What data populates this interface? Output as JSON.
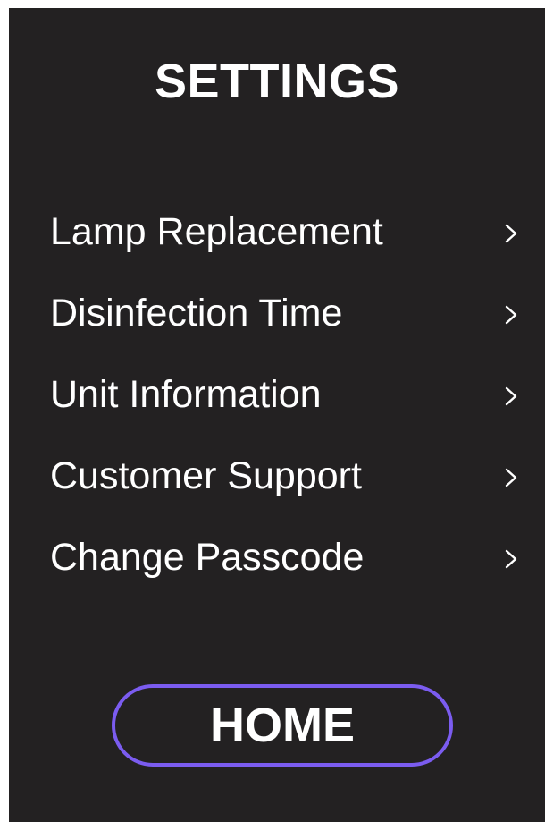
{
  "header": {
    "title": "SETTINGS"
  },
  "menu": {
    "items": [
      {
        "label": "Lamp Replacement",
        "icon": "chevron-right-icon"
      },
      {
        "label": "Disinfection Time",
        "icon": "chevron-right-icon"
      },
      {
        "label": "Unit Information",
        "icon": "chevron-right-icon"
      },
      {
        "label": "Customer Support",
        "icon": "chevron-right-icon"
      },
      {
        "label": "Change Passcode",
        "icon": "chevron-right-icon"
      }
    ]
  },
  "footer": {
    "home_label": "HOME"
  },
  "colors": {
    "background": "#232122",
    "text": "#ffffff",
    "accent": "#7b5cf0"
  }
}
